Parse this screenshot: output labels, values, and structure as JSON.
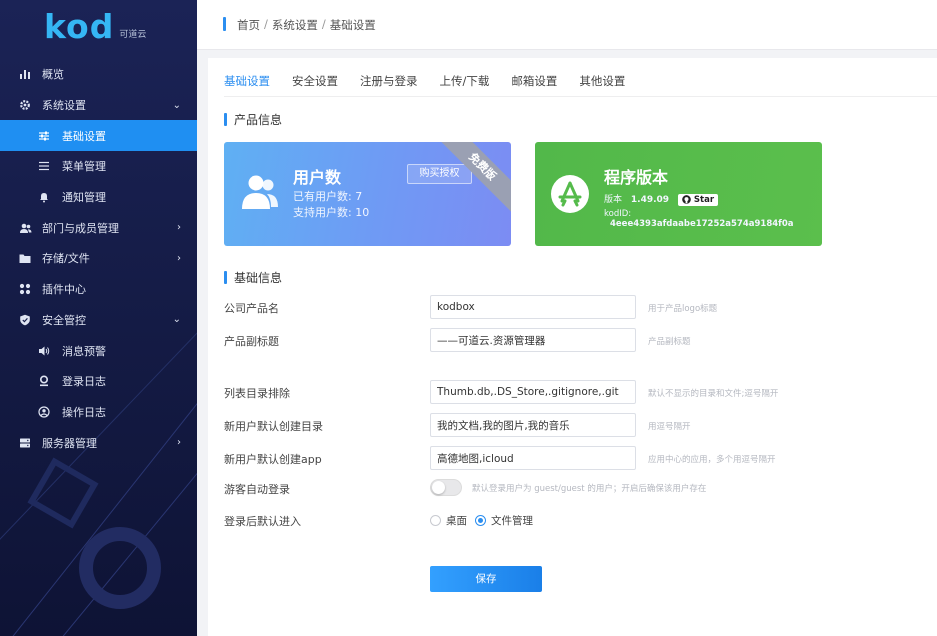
{
  "app": {
    "logo_text": "kod",
    "logo_sub": "可道云"
  },
  "sidebar": {
    "items": [
      {
        "label": "概览",
        "icon": "chart-bar-icon"
      },
      {
        "label": "系统设置",
        "icon": "gear-icon",
        "expanded": true
      },
      {
        "label": "基础设置",
        "icon": "sliders-icon",
        "active": true
      },
      {
        "label": "菜单管理",
        "icon": "menu-icon"
      },
      {
        "label": "通知管理",
        "icon": "bell-icon"
      },
      {
        "label": "部门与成员管理",
        "icon": "users-icon"
      },
      {
        "label": "存储/文件",
        "icon": "folder-icon"
      },
      {
        "label": "插件中心",
        "icon": "grid-icon"
      },
      {
        "label": "安全管控",
        "icon": "shield-icon",
        "expanded": true
      },
      {
        "label": "消息预警",
        "icon": "speaker-icon"
      },
      {
        "label": "登录日志",
        "icon": "user-log-icon"
      },
      {
        "label": "操作日志",
        "icon": "user-ops-icon"
      },
      {
        "label": "服务器管理",
        "icon": "server-icon"
      }
    ]
  },
  "header": {
    "breadcrumb": [
      "首页",
      "系统设置",
      "基础设置"
    ],
    "separator": "/"
  },
  "tabs": [
    {
      "label": "基础设置",
      "active": true
    },
    {
      "label": "安全设置"
    },
    {
      "label": "注册与登录"
    },
    {
      "label": "上传/下载"
    },
    {
      "label": "邮箱设置"
    },
    {
      "label": "其他设置"
    }
  ],
  "product": {
    "section_title": "产品信息",
    "users_card": {
      "title": "用户数",
      "existing": "已有用户数:  7",
      "supported": "支持用户数:  10",
      "buy_label": "购买授权",
      "ribbon": "免费版"
    },
    "version_card": {
      "title": "程序版本",
      "version_label": "版本",
      "version_value": "1.49.09",
      "star_label": "Star",
      "kodid_label": "kodID:",
      "kodid_value": "4eee4393afdaabe17252a574a9184f0a"
    },
    "colors": {
      "users_card": "#6f9af4",
      "version_card": "#55bb4b",
      "accent": "#2b8ef0"
    }
  },
  "basic": {
    "section_title": "基础信息",
    "fields": [
      {
        "label": "公司产品名",
        "value": "kodbox",
        "hint": "用于产品logo标题"
      },
      {
        "label": "产品副标题",
        "value": "——可道云.资源管理器",
        "hint": "产品副标题"
      },
      {
        "label": "列表目录排除",
        "value": "Thumb.db,.DS_Store,.gitignore,.git",
        "hint": "默认不显示的目录和文件;逗号隔开"
      },
      {
        "label": "新用户默认创建目录",
        "value": "我的文档,我的图片,我的音乐",
        "hint": "用逗号隔开"
      },
      {
        "label": "新用户默认创建app",
        "value": "高德地图,icloud",
        "hint": "应用中心的应用，多个用逗号隔开"
      }
    ],
    "guest_login": {
      "label": "游客自动登录",
      "enabled": false,
      "hint": "默认登录用户为 guest/guest 的用户；开启后确保该用户存在"
    },
    "default_entry": {
      "label": "登录后默认进入",
      "options": [
        "桌面",
        "文件管理"
      ],
      "selected": "文件管理"
    },
    "save_label": "保存"
  }
}
